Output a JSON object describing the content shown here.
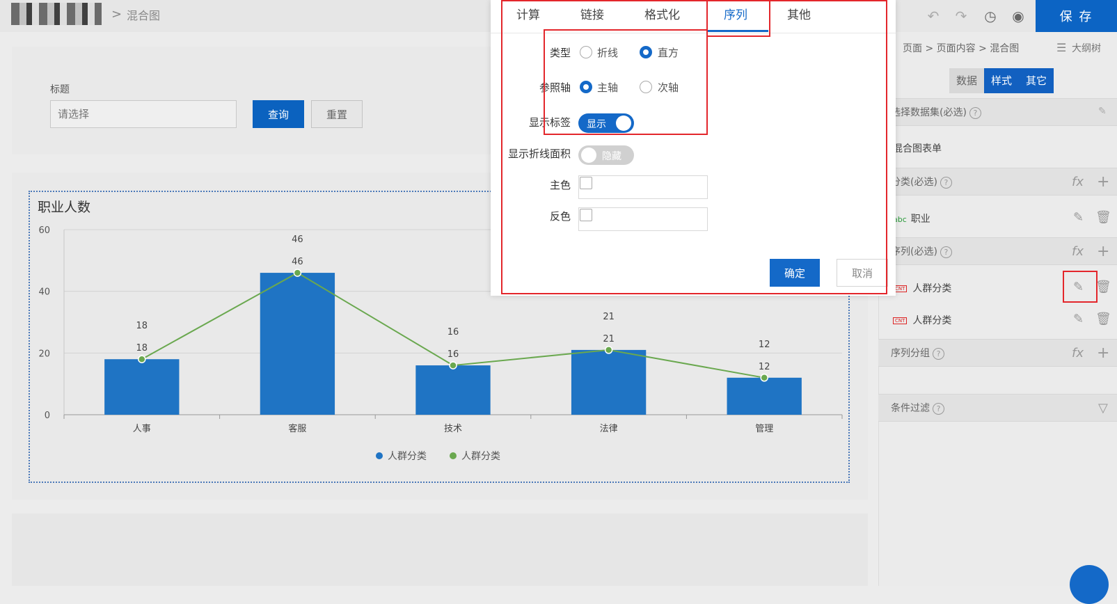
{
  "topbar": {
    "breadcrumb_separator": ">",
    "page_title": "混合图",
    "save_label": "保 存"
  },
  "filter": {
    "label": "标题",
    "placeholder": "请选择",
    "query_label": "查询",
    "reset_label": "重置"
  },
  "chart_data": {
    "type": "bar",
    "title": "职业人数",
    "categories": [
      "人事",
      "客服",
      "技术",
      "法律",
      "管理"
    ],
    "ylim": [
      0,
      60
    ],
    "yticks": [
      0,
      20,
      40,
      60
    ],
    "grid": true,
    "legend": "bottom-center",
    "series": [
      {
        "name": "人群分类",
        "kind": "bar",
        "color": "#1f74c4",
        "values": [
          18,
          46,
          16,
          21,
          12
        ]
      },
      {
        "name": "人群分类",
        "kind": "line",
        "color": "#6aa84f",
        "values": [
          18,
          46,
          16,
          21,
          12
        ]
      }
    ]
  },
  "right_panel": {
    "breadcrumb": "页面 > 页面内容 > 混合图",
    "outline_label": "大纲树",
    "tabs": [
      "数据",
      "样式",
      "其它"
    ],
    "active_tab": "样式",
    "dataset_label": "选择数据集(必选)",
    "dataset_value": "混合图表单",
    "category_label": "分类(必选)",
    "category_item_tag": "abc",
    "category_item": "职业",
    "series_label": "序列(必选)",
    "series_item_tag": "CNT",
    "series_items": [
      "人群分类",
      "人群分类"
    ],
    "series_group_label": "序列分组",
    "filter_label": "条件过滤",
    "fx": "fx",
    "plus": "+",
    "help": "?"
  },
  "modal": {
    "tabs": [
      "计算",
      "链接",
      "格式化",
      "序列",
      "其他"
    ],
    "active_tab": "序列",
    "type_label": "类型",
    "type_options": [
      "折线",
      "直方"
    ],
    "type_selected": "直方",
    "axis_label": "参照轴",
    "axis_options": [
      "主轴",
      "次轴"
    ],
    "axis_selected": "主轴",
    "show_label_label": "显示标签",
    "show_label_text": "显示",
    "show_area_label": "显示折线面积",
    "show_area_text": "隐藏",
    "main_color_label": "主色",
    "inverse_color_label": "反色",
    "ok_label": "确定",
    "cancel_label": "取消"
  },
  "colors": {
    "accent": "#1469c8",
    "annotation": "#e3262b"
  }
}
